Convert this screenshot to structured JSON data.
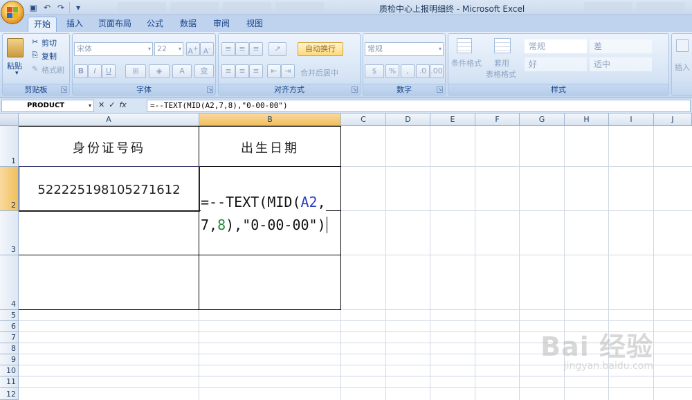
{
  "window": {
    "title": "质检中心上报明细终 - Microsoft Excel"
  },
  "tabs": [
    "开始",
    "插入",
    "页面布局",
    "公式",
    "数据",
    "审阅",
    "视图"
  ],
  "active_tab": "开始",
  "ribbon": {
    "clipboard": {
      "label": "剪贴板",
      "paste": "粘贴",
      "cut": "剪切",
      "copy": "复制",
      "format_painter": "格式刷"
    },
    "font": {
      "label": "字体",
      "font_name": "宋体",
      "font_size": "22",
      "bold": "B",
      "italic": "I",
      "underline": "U",
      "phonetic": "变"
    },
    "alignment": {
      "label": "对齐方式",
      "wrap_text": "自动换行",
      "merge_center": "合并后居中"
    },
    "number": {
      "label": "数字",
      "format": "常规",
      "percent": "%",
      "comma": ","
    },
    "styles": {
      "label": "样式",
      "conditional_format": "条件格式",
      "table_format_1": "套用",
      "table_format_2": "表格格式",
      "cell_normal": "常规",
      "cell_bad": "差",
      "cell_good": "好",
      "cell_neutral": "适中"
    },
    "cells": {
      "insert": "插入"
    }
  },
  "formula_bar": {
    "name_box": "PRODUCT",
    "fx": "fx",
    "formula": "=--TEXT(MID(A2,7,8),\"0-00-00\")"
  },
  "columns": [
    "A",
    "B",
    "C",
    "D",
    "E",
    "F",
    "G",
    "H",
    "I",
    "J"
  ],
  "rows": [
    "1",
    "2",
    "3",
    "4",
    "5",
    "6",
    "7",
    "8",
    "9",
    "10",
    "11",
    "12"
  ],
  "cells": {
    "A1": "身份证号码",
    "B1": "出生日期",
    "A2": "522225198105271612"
  },
  "editing": {
    "line1_prefix": "=--TEXT(MID(",
    "line1_ref": "A2",
    "line1_suffix": ",",
    "line2_num": "7,",
    "line2_arg": "8",
    "line2_suffix": "),\"0-00-00\")"
  },
  "watermark": {
    "main": "Bai 经验",
    "sub": "jingyan.baidu.com"
  }
}
